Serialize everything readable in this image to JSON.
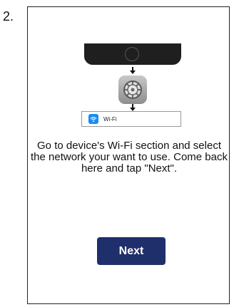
{
  "step": {
    "number": "2."
  },
  "illustration": {
    "settings_icon": "settings-gear-icon",
    "down_arrow_icon": "arrow-down-icon",
    "wifi_icon": "wifi-icon",
    "wifi_label": "Wi-Fi"
  },
  "instructions": {
    "text": "Go to device's Wi-Fi section and select the network your want to use. Come back here and tap \"Next\"."
  },
  "actions": {
    "next_label": "Next"
  },
  "colors": {
    "next_button": "#1f2f6b",
    "wifi_badge": "#1a8cf0",
    "phone": "#1f1f1f"
  }
}
